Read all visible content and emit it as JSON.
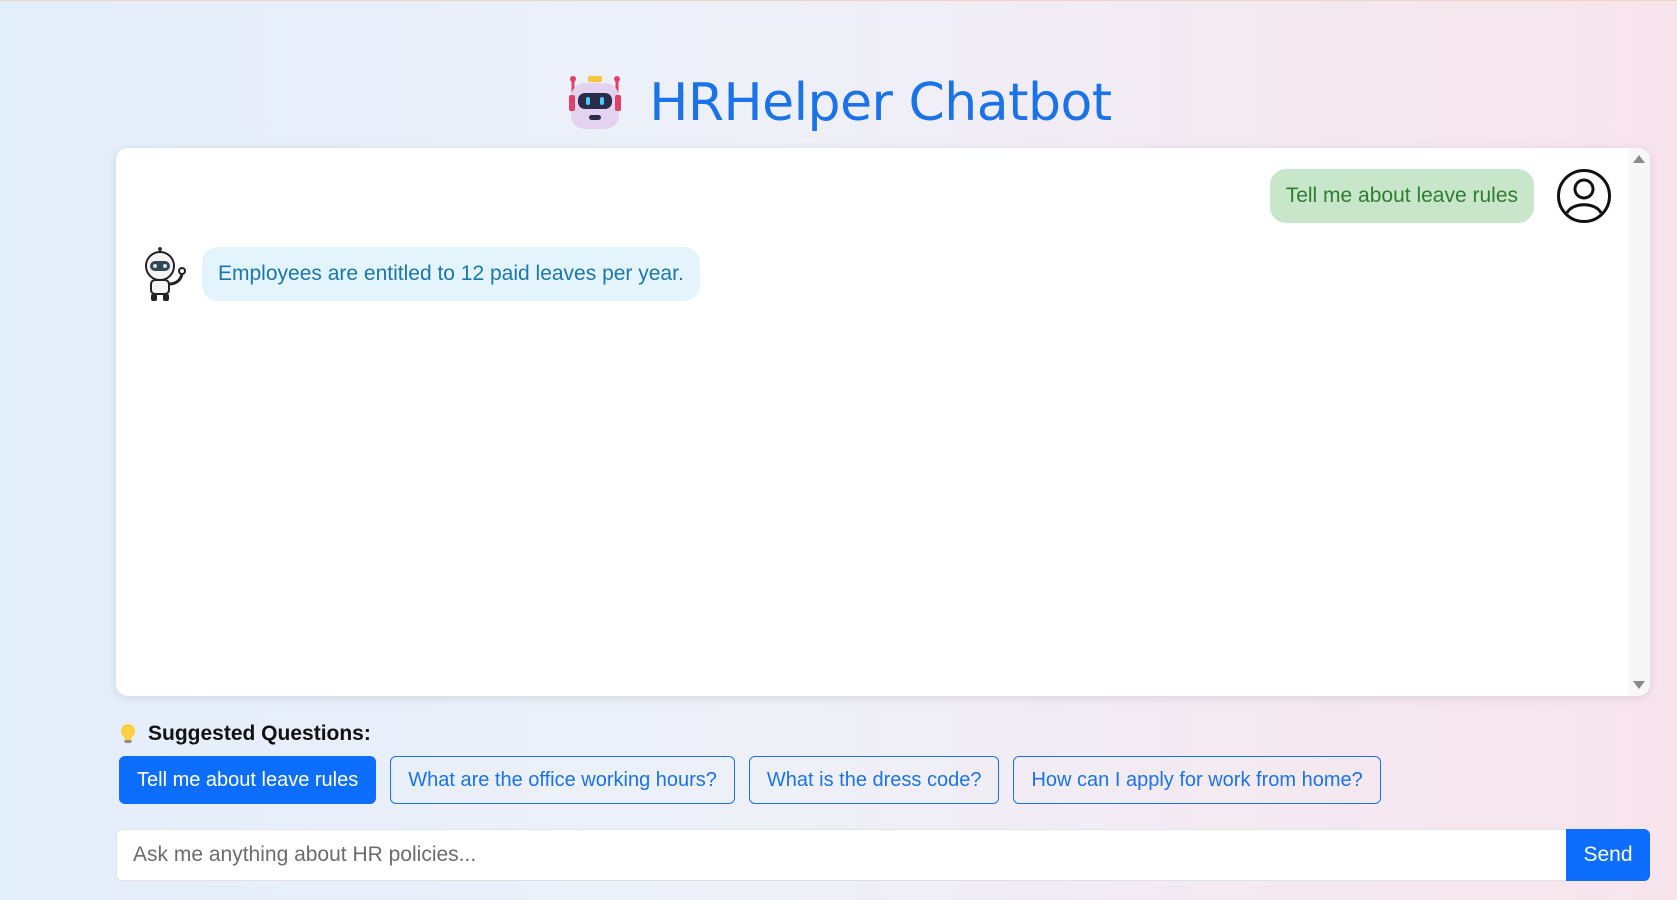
{
  "header": {
    "icon": "robot-icon",
    "title": "HRHelper Chatbot"
  },
  "chat": {
    "messages": [
      {
        "sender": "user",
        "text": "Tell me about leave rules",
        "avatar": "user-circle-icon"
      },
      {
        "sender": "bot",
        "text": "Employees are entitled to 12 paid leaves per year.",
        "avatar": "bot-avatar-icon"
      }
    ]
  },
  "suggestions": {
    "icon": "lightbulb-icon",
    "heading": "Suggested Questions:",
    "items": [
      {
        "label": "Tell me about leave rules",
        "active": true
      },
      {
        "label": "What are the office working hours?",
        "active": false
      },
      {
        "label": "What is the dress code?",
        "active": false
      },
      {
        "label": "How can I apply for work from home?",
        "active": false
      }
    ]
  },
  "composer": {
    "placeholder": "Ask me anything about HR policies...",
    "send_label": "Send"
  },
  "colors": {
    "accent": "#1a73e8",
    "button": "#0d6efd",
    "user_bubble": "#c8e6c9",
    "bot_bubble": "#e3f4fc"
  }
}
